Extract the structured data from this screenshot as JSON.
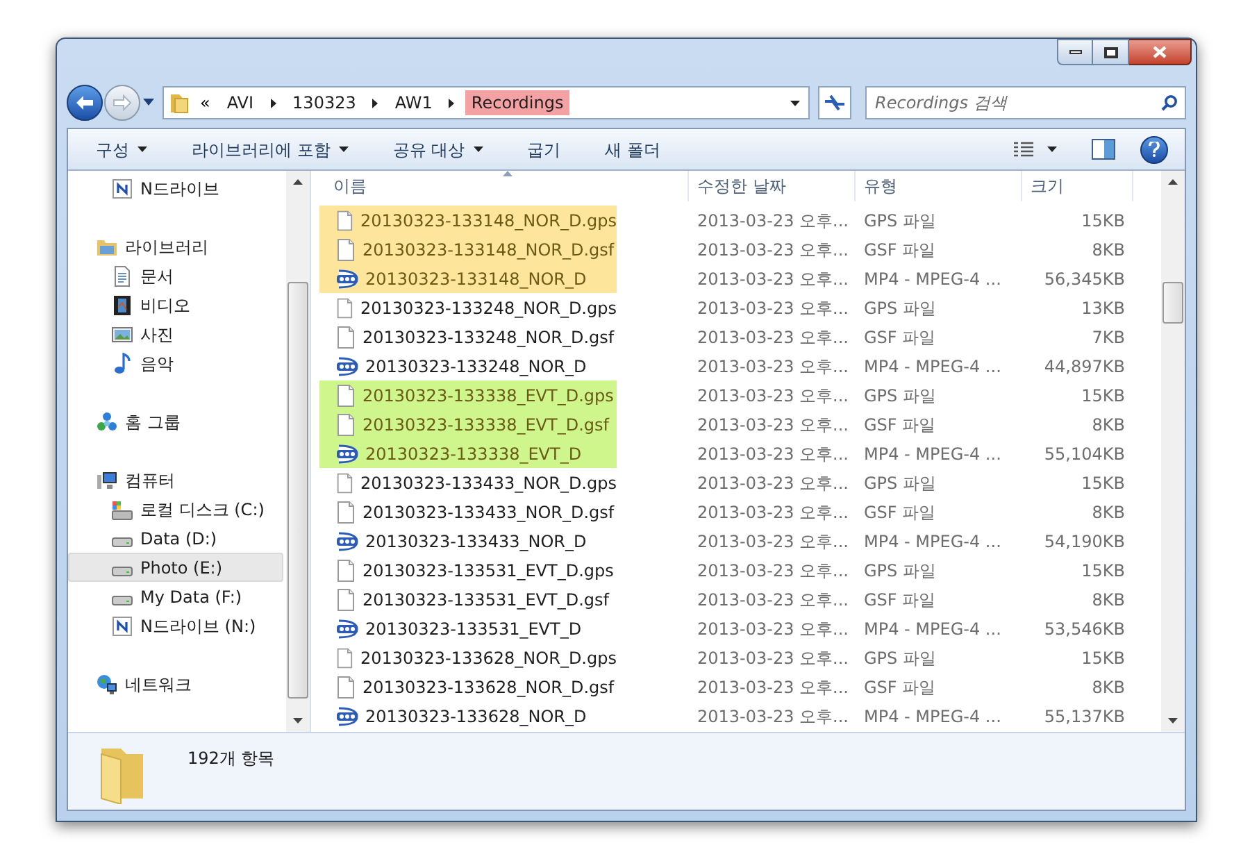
{
  "breadcrumb": {
    "overflow": "«",
    "segments": [
      {
        "label": "AVI",
        "marked": false
      },
      {
        "label": "130323",
        "marked": false
      },
      {
        "label": "AW1",
        "marked": false
      },
      {
        "label": "Recordings",
        "marked": true
      }
    ]
  },
  "search": {
    "placeholder": "Recordings 검색"
  },
  "toolbar": {
    "buttons": [
      {
        "label": "구성",
        "menu": true
      },
      {
        "label": "라이브러리에 포함",
        "menu": true
      },
      {
        "label": "공유 대상",
        "menu": true
      },
      {
        "label": "굽기",
        "menu": false
      },
      {
        "label": "새 폴더",
        "menu": false
      }
    ]
  },
  "sidebar": {
    "groups": [
      {
        "children": [
          {
            "label": "N드라이브",
            "kind": "ndrive",
            "selected": false
          }
        ]
      },
      {
        "label": "라이브러리",
        "kind": "library",
        "children": [
          {
            "label": "문서",
            "kind": "doc",
            "selected": false
          },
          {
            "label": "비디오",
            "kind": "video",
            "selected": false
          },
          {
            "label": "사진",
            "kind": "picture",
            "selected": false
          },
          {
            "label": "음악",
            "kind": "music",
            "selected": false
          }
        ]
      },
      {
        "label": "홈 그룹",
        "kind": "homegroup"
      },
      {
        "label": "컴퓨터",
        "kind": "computer",
        "children": [
          {
            "label": "로컬 디스크 (C:)",
            "kind": "osdisk",
            "selected": false
          },
          {
            "label": "Data (D:)",
            "kind": "disk",
            "selected": false
          },
          {
            "label": "Photo (E:)",
            "kind": "disk",
            "selected": true
          },
          {
            "label": "My Data (F:)",
            "kind": "disk",
            "selected": false
          },
          {
            "label": "N드라이브 (N:)",
            "kind": "ndrive",
            "selected": false
          }
        ]
      },
      {
        "label": "네트워크",
        "kind": "network"
      }
    ]
  },
  "table": {
    "columns": [
      "이름",
      "수정한 날짜",
      "유형",
      "크기"
    ],
    "rows": [
      {
        "name": "20130323-133148_NOR_D.gps",
        "date": "2013-03-23 오후...",
        "type": "GPS 파일",
        "size": "15KB",
        "kind": "file",
        "color": "#fde59b"
      },
      {
        "name": "20130323-133148_NOR_D.gsf",
        "date": "2013-03-23 오후...",
        "type": "GSF 파일",
        "size": "8KB",
        "kind": "file",
        "color": "#fde59b"
      },
      {
        "name": "20130323-133148_NOR_D",
        "date": "2013-03-23 오후...",
        "type": "MP4 - MPEG-4 ...",
        "size": "56,345KB",
        "kind": "video",
        "color": "#fde59b"
      },
      {
        "name": "20130323-133248_NOR_D.gps",
        "date": "2013-03-23 오후...",
        "type": "GPS 파일",
        "size": "13KB",
        "kind": "file"
      },
      {
        "name": "20130323-133248_NOR_D.gsf",
        "date": "2013-03-23 오후...",
        "type": "GSF 파일",
        "size": "7KB",
        "kind": "file"
      },
      {
        "name": "20130323-133248_NOR_D",
        "date": "2013-03-23 오후...",
        "type": "MP4 - MPEG-4 ...",
        "size": "44,897KB",
        "kind": "video"
      },
      {
        "name": "20130323-133338_EVT_D.gps",
        "date": "2013-03-23 오후...",
        "type": "GPS 파일",
        "size": "15KB",
        "kind": "file",
        "color": "#cef68c"
      },
      {
        "name": "20130323-133338_EVT_D.gsf",
        "date": "2013-03-23 오후...",
        "type": "GSF 파일",
        "size": "8KB",
        "kind": "file",
        "color": "#cef68c"
      },
      {
        "name": "20130323-133338_EVT_D",
        "date": "2013-03-23 오후...",
        "type": "MP4 - MPEG-4 ...",
        "size": "55,104KB",
        "kind": "video",
        "color": "#cef68c"
      },
      {
        "name": "20130323-133433_NOR_D.gps",
        "date": "2013-03-23 오후...",
        "type": "GPS 파일",
        "size": "15KB",
        "kind": "file"
      },
      {
        "name": "20130323-133433_NOR_D.gsf",
        "date": "2013-03-23 오후...",
        "type": "GSF 파일",
        "size": "8KB",
        "kind": "file"
      },
      {
        "name": "20130323-133433_NOR_D",
        "date": "2013-03-23 오후...",
        "type": "MP4 - MPEG-4 ...",
        "size": "54,190KB",
        "kind": "video"
      },
      {
        "name": "20130323-133531_EVT_D.gps",
        "date": "2013-03-23 오후...",
        "type": "GPS 파일",
        "size": "15KB",
        "kind": "file"
      },
      {
        "name": "20130323-133531_EVT_D.gsf",
        "date": "2013-03-23 오후...",
        "type": "GSF 파일",
        "size": "8KB",
        "kind": "file"
      },
      {
        "name": "20130323-133531_EVT_D",
        "date": "2013-03-23 오후...",
        "type": "MP4 - MPEG-4 ...",
        "size": "53,546KB",
        "kind": "video"
      },
      {
        "name": "20130323-133628_NOR_D.gps",
        "date": "2013-03-23 오후...",
        "type": "GPS 파일",
        "size": "15KB",
        "kind": "file"
      },
      {
        "name": "20130323-133628_NOR_D.gsf",
        "date": "2013-03-23 오후...",
        "type": "GSF 파일",
        "size": "8KB",
        "kind": "file"
      },
      {
        "name": "20130323-133628_NOR_D",
        "date": "2013-03-23 오후...",
        "type": "MP4 - MPEG-4 ...",
        "size": "55,137KB",
        "kind": "video"
      }
    ]
  },
  "status_bar": {
    "count": "192개 항목"
  }
}
